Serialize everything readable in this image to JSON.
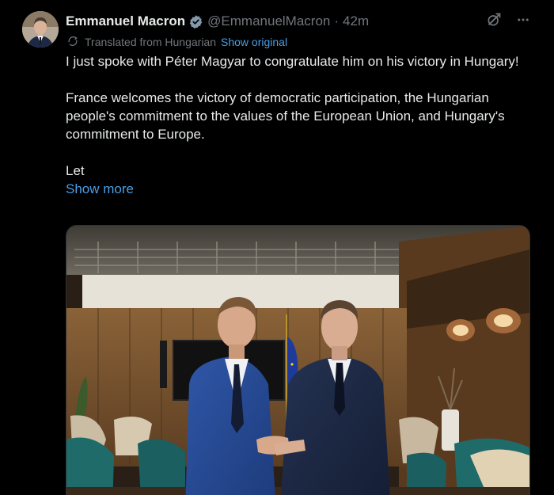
{
  "author": {
    "name": "Emmanuel Macron",
    "handle": "@EmmanuelMacron",
    "separator": "·",
    "time": "42m",
    "verified_icon": "verified-badge-icon"
  },
  "translation": {
    "label": "Translated from Hungarian",
    "action": "Show original"
  },
  "post": {
    "paragraphs": [
      "I just spoke with Péter Magyar to congratulate him on his victory in Hungary!",
      "France welcomes the victory of democratic participation, the Hungarian people's commitment to the values of the European Union, and Hungary's commitment to Europe.",
      "Let"
    ],
    "show_more": "Show more"
  },
  "icons": {
    "grok": "grok-icon",
    "more": "more-options-icon",
    "translate": "translate-icon"
  },
  "colors": {
    "background": "#000000",
    "text": "#e7e9ea",
    "muted": "#71767b",
    "link": "#4a9ee6",
    "verified": "#829aab"
  }
}
